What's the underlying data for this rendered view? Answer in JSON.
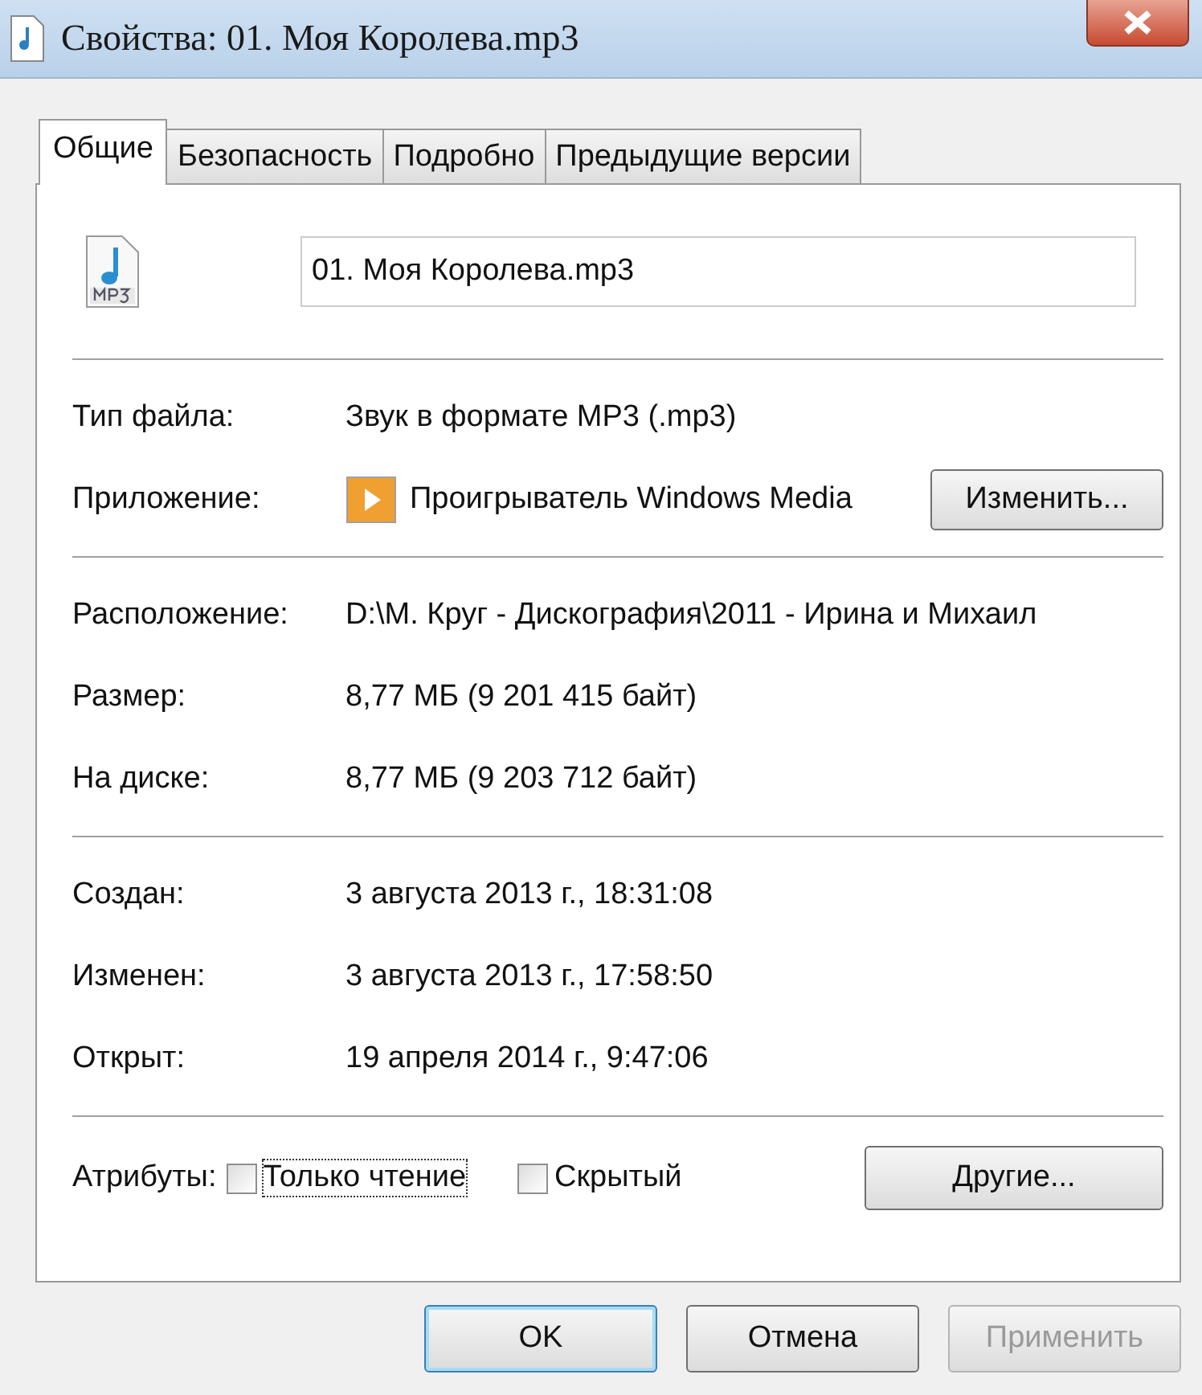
{
  "window": {
    "title": "Свойства: 01. Моя Королева.mp3"
  },
  "tabs": [
    {
      "label": "Общие",
      "selected": true
    },
    {
      "label": "Безопасность",
      "selected": false
    },
    {
      "label": "Подробно",
      "selected": false
    },
    {
      "label": "Предыдущие версии",
      "selected": false
    }
  ],
  "file_name": "01. Моя Королева.mp3",
  "sections": [
    [
      {
        "label": "Тип файла:",
        "value": "Звук в формате MP3 (.mp3)"
      },
      {
        "label": "Приложение:",
        "value": "Проигрыватель Windows Media",
        "kind": "app",
        "button": "Изменить..."
      }
    ],
    [
      {
        "label": "Расположение:",
        "value": "D:\\М. Круг - Дискография\\2011 - Ирина и Михаил"
      },
      {
        "label": "Размер:",
        "value": "8,77 МБ (9 201 415 байт)"
      },
      {
        "label": "На диске:",
        "value": "8,77 МБ (9 203 712 байт)"
      }
    ],
    [
      {
        "label": "Создан:",
        "value": "3 августа 2013 г., 18:31:08"
      },
      {
        "label": "Изменен:",
        "value": "3 августа 2013 г., 17:58:50"
      },
      {
        "label": "Открыт:",
        "value": "19 апреля 2014 г., 9:47:06"
      }
    ]
  ],
  "attributes": {
    "label": "Атрибуты:",
    "items": [
      {
        "label": "Только чтение",
        "checked": false,
        "focused": true
      },
      {
        "label": "Скрытый",
        "checked": false,
        "focused": false
      }
    ],
    "button": "Другие..."
  },
  "buttons": [
    {
      "label": "OK",
      "kind": "default",
      "disabled": false
    },
    {
      "label": "Отмена",
      "kind": "normal",
      "disabled": false
    },
    {
      "label": "Применить",
      "kind": "normal",
      "disabled": true
    }
  ]
}
